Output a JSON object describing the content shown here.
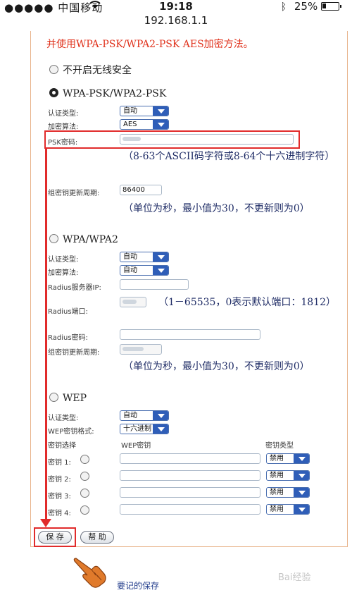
{
  "status_bar": {
    "carrier": "●●●●● 中国移动",
    "time": "19:18",
    "battery": "25%"
  },
  "url": "192.168.1.1",
  "intro_text": "并使用WPA-PSK/WPA2-PSK AES加密方法。",
  "no_security": {
    "label": "不开启无线安全"
  },
  "wpa_psk": {
    "title": "WPA-PSK/WPA2-PSK",
    "auth_type_label": "认证类型:",
    "auth_type_value": "自动",
    "encryption_label": "加密算法:",
    "encryption_value": "AES",
    "psk_label": "PSK密码:",
    "psk_note": "（8-63个ASCII码字符或8-64个十六进制字符）",
    "group_key_label": "组密钥更新周期:",
    "group_key_value": "86400",
    "group_key_note": "（单位为秒，最小值为30，不更新则为0）"
  },
  "wpa": {
    "title": "WPA/WPA2",
    "auth_type_label": "认证类型:",
    "auth_type_value": "自动",
    "encryption_label": "加密算法:",
    "encryption_value": "自动",
    "radius_ip_label": "Radius服务器IP:",
    "radius_port_label": "Radius端口:",
    "radius_port_note": "（1－65535，0表示默认端口：1812）",
    "radius_pwd_label": "Radius密码:",
    "group_key_label": "组密钥更新周期:",
    "group_key_note": "（单位为秒，最小值为30，不更新则为0）"
  },
  "wep": {
    "title": "WEP",
    "auth_type_label": "认证类型:",
    "auth_type_value": "自动",
    "key_format_label": "WEP密钥格式:",
    "key_format_value": "十六进制",
    "col_select": "密钥选择",
    "col_key": "WEP密钥",
    "col_type": "密钥类型",
    "keys": [
      {
        "label": "密钥 1:",
        "type": "禁用"
      },
      {
        "label": "密钥 2:",
        "type": "禁用"
      },
      {
        "label": "密钥 3:",
        "type": "禁用"
      },
      {
        "label": "密钥 4:",
        "type": "禁用"
      }
    ]
  },
  "buttons": {
    "save": "保 存",
    "help": "帮 助"
  },
  "annotation": "要记的保存",
  "watermark": "Bai经验"
}
